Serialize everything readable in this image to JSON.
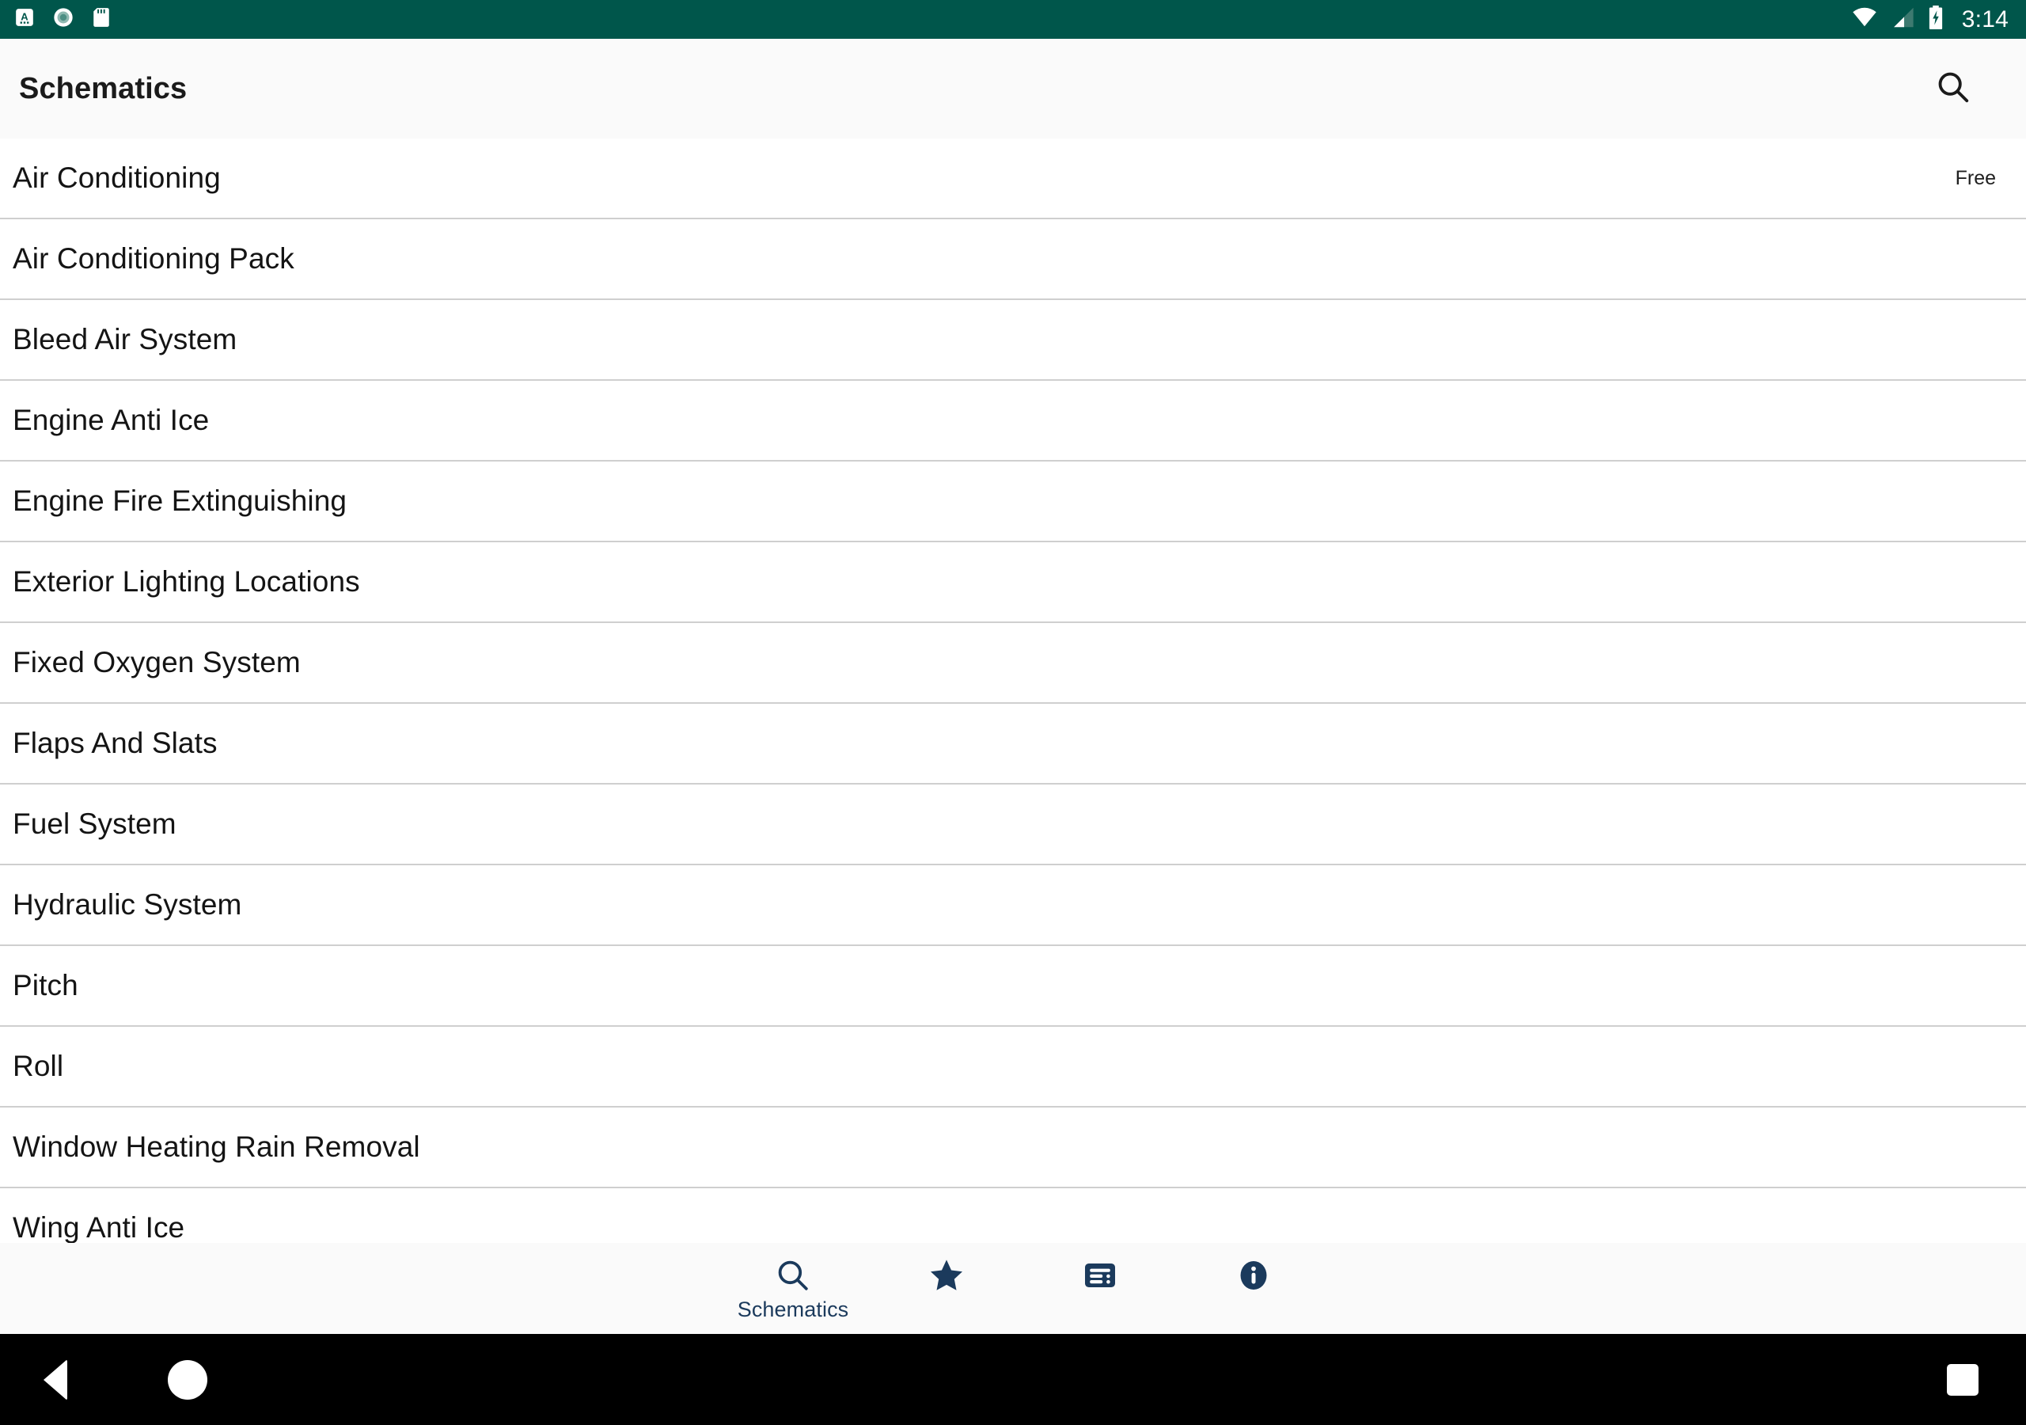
{
  "status_bar": {
    "time": "3:14",
    "background_color": "#00564b",
    "icons": [
      "app-notification-icon",
      "record-notification-icon",
      "sd-card-notification-icon",
      "wifi-icon",
      "cellular-signal-icon",
      "battery-charging-icon"
    ]
  },
  "app_bar": {
    "title": "Schematics",
    "background_color": "#fafafa",
    "search_icon": "search-icon"
  },
  "list": {
    "rows": [
      {
        "label": "Air Conditioning",
        "badge": "Free"
      },
      {
        "label": "Air Conditioning Pack",
        "badge": ""
      },
      {
        "label": "Bleed Air System",
        "badge": ""
      },
      {
        "label": "Engine Anti Ice",
        "badge": ""
      },
      {
        "label": "Engine Fire Extinguishing",
        "badge": ""
      },
      {
        "label": "Exterior Lighting Locations",
        "badge": ""
      },
      {
        "label": "Fixed Oxygen System",
        "badge": ""
      },
      {
        "label": "Flaps And Slats",
        "badge": ""
      },
      {
        "label": "Fuel System",
        "badge": ""
      },
      {
        "label": "Hydraulic System",
        "badge": ""
      },
      {
        "label": "Pitch",
        "badge": ""
      },
      {
        "label": "Roll",
        "badge": ""
      },
      {
        "label": "Window Heating Rain Removal",
        "badge": ""
      },
      {
        "label": "Wing Anti Ice",
        "badge": ""
      }
    ]
  },
  "bottom_nav": {
    "accent_color": "#1b3a5c",
    "background_color": "#fafafa",
    "items": [
      {
        "label": "Schematics",
        "icon": "search-icon",
        "selected": true
      },
      {
        "label": "",
        "icon": "star-icon",
        "selected": false
      },
      {
        "label": "",
        "icon": "list-alt-icon",
        "selected": false
      },
      {
        "label": "",
        "icon": "info-icon",
        "selected": false
      }
    ]
  },
  "system_nav": {
    "background_color": "#000000",
    "buttons": [
      "back-button",
      "home-button",
      "recent-apps-button"
    ]
  }
}
